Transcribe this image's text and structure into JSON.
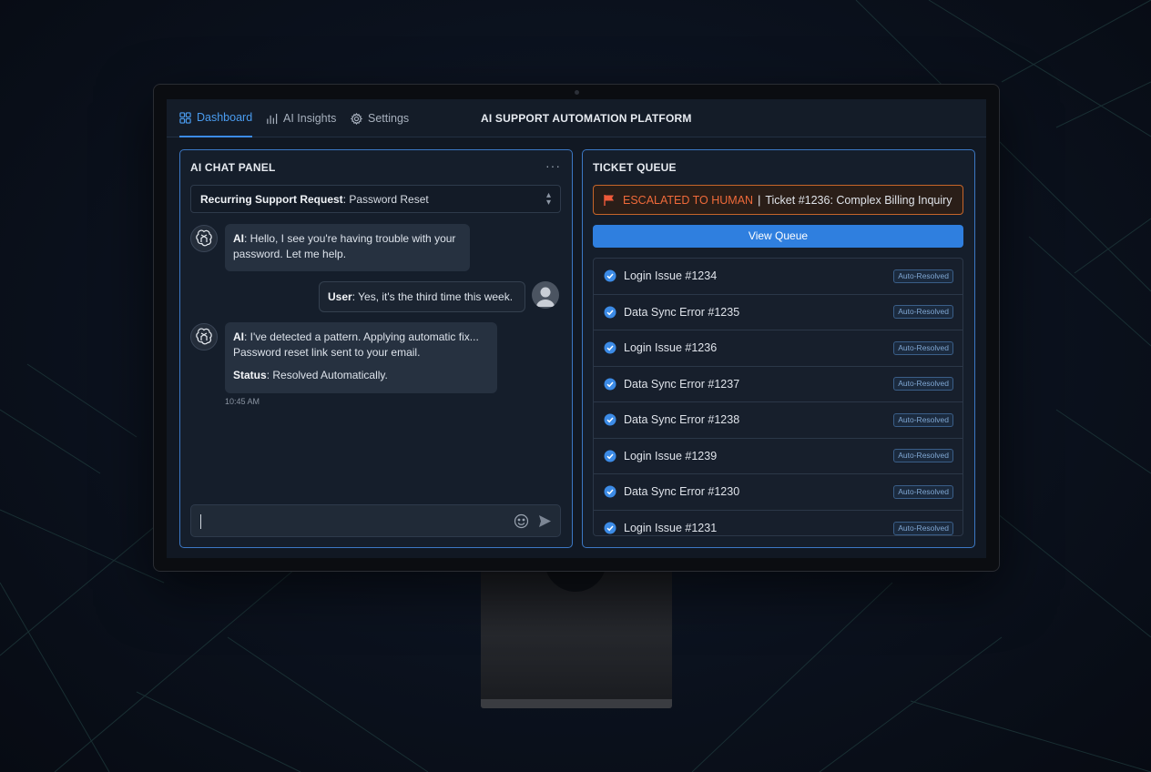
{
  "nav": {
    "tabs": [
      {
        "label": "Dashboard",
        "icon": "dashboard-icon",
        "active": true
      },
      {
        "label": "AI Insights",
        "icon": "bar-chart-icon",
        "active": false
      },
      {
        "label": "Settings",
        "icon": "gear-icon",
        "active": false
      }
    ],
    "app_title": "AI SUPPORT AUTOMATION PLATFORM"
  },
  "chat": {
    "title": "AI CHAT PANEL",
    "more_label": "···",
    "request_label": "Recurring Support Request",
    "request_value": ": Password Reset",
    "messages": [
      {
        "speaker": "AI",
        "text": ": Hello, I see you're having trouble with your",
        "text2": "password. Let me help."
      },
      {
        "speaker": "User",
        "text": ": Yes, it's the third time this week."
      },
      {
        "speaker": "AI",
        "text": ": I've detected a pattern. Applying automatic fix...",
        "text2": "Password reset link sent to your email.",
        "status_label": "Status",
        "status_value": ": Resolved Automatically."
      }
    ],
    "timestamp": "10:45 AM",
    "input_value": ""
  },
  "queue": {
    "title": "TICKET QUEUE",
    "escalation_label": "ESCALATED TO HUMAN",
    "escalation_separator": "|",
    "escalation_ticket": "Ticket #1236: Complex Billing Inquiry",
    "view_button": "View Queue",
    "tickets": [
      {
        "name": "Login Issue #1234",
        "status": "Auto-Resolved"
      },
      {
        "name": "Data Sync Error #1235",
        "status": "Auto-Resolved"
      },
      {
        "name": "Login Issue #1236",
        "status": "Auto-Resolved"
      },
      {
        "name": "Data Sync Error #1237",
        "status": "Auto-Resolved"
      },
      {
        "name": "Data Sync Error #1238",
        "status": "Auto-Resolved"
      },
      {
        "name": "Login Issue #1239",
        "status": "Auto-Resolved"
      },
      {
        "name": "Data Sync Error #1230",
        "status": "Auto-Resolved"
      },
      {
        "name": "Login Issue #1231",
        "status": "Auto-Resolved"
      }
    ]
  },
  "colors": {
    "accent": "#3c8be6",
    "escalation": "#ef6a3a",
    "panel_border": "#3c78c4"
  }
}
